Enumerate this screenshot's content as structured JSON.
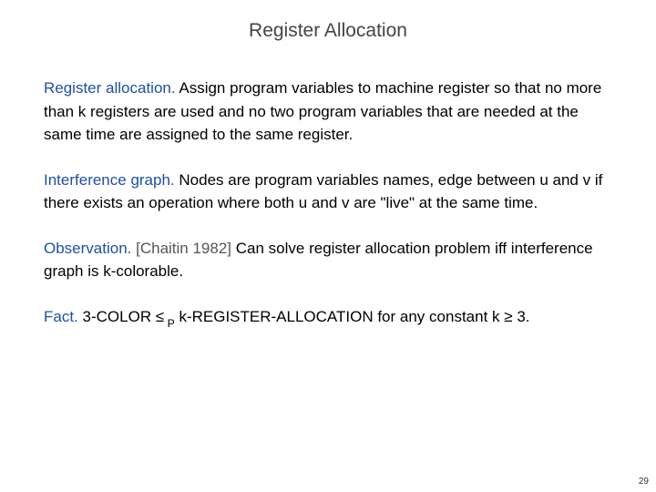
{
  "title": "Register Allocation",
  "p1": {
    "lead": "Register allocation.",
    "body": "  Assign program variables to machine register so that no more than k registers are used and no two program variables that are needed at the same time are assigned to the same register."
  },
  "p2": {
    "lead": "Interference graph.",
    "body": "  Nodes are program variables names, edge between u and v if there exists an operation where both u and v are \"live\" at the same time."
  },
  "p3": {
    "lead": "Observation.",
    "cite": "  [Chaitin 1982]",
    "body": "  Can solve register allocation problem iff interference graph is k-colorable."
  },
  "p4": {
    "lead": "Fact.",
    "pre": "  3-COLOR ",
    "rel": "≤",
    "sub": " P",
    "post": " k-REGISTER-ALLOCATION for any constant k ",
    "geq": "≥",
    "end": " 3."
  },
  "page_number": "29"
}
